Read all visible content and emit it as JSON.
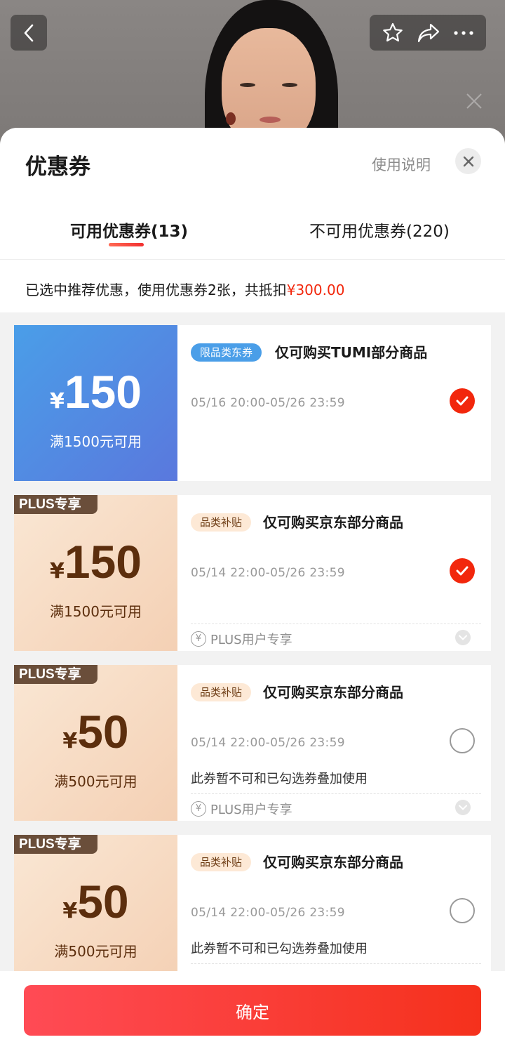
{
  "sheet": {
    "title": "优惠券",
    "usage_link": "使用说明",
    "tabs": [
      {
        "label": "可用优惠券(13)",
        "active": true
      },
      {
        "label": "不可用优惠券(220)",
        "active": false
      }
    ],
    "summary_prefix": "已选中推荐优惠，使用优惠券2张，共抵扣",
    "summary_amount": "¥300.00"
  },
  "coupons": [
    {
      "style": "blue",
      "plus_tag": "",
      "currency": "¥",
      "amount": "150",
      "condition": "满1500元可用",
      "tag": "限品类东券",
      "title": "仅可购买TUMI部分商品",
      "date": "05/16 20:00-05/26 23:59",
      "note": "",
      "selected": true,
      "plus_user": ""
    },
    {
      "style": "plus",
      "plus_tag": "PLUS专享",
      "currency": "¥",
      "amount": "150",
      "condition": "满1500元可用",
      "tag": "品类补贴",
      "title": "仅可购买京东部分商品",
      "date": "05/14 22:00-05/26 23:59",
      "note": "",
      "selected": true,
      "plus_user": "PLUS用户专享"
    },
    {
      "style": "plus",
      "plus_tag": "PLUS专享",
      "currency": "¥",
      "amount": "50",
      "condition": "满500元可用",
      "tag": "品类补贴",
      "title": "仅可购买京东部分商品",
      "date": "05/14 22:00-05/26 23:59",
      "note": "此券暂不可和已勾选券叠加使用",
      "selected": false,
      "plus_user": "PLUS用户专享"
    },
    {
      "style": "plus",
      "plus_tag": "PLUS专享",
      "currency": "¥",
      "amount": "50",
      "condition": "满500元可用",
      "tag": "品类补贴",
      "title": "仅可购买京东部分商品",
      "date": "05/14 22:00-05/26 23:59",
      "note": "此券暂不可和已勾选券叠加使用",
      "selected": false,
      "plus_user": ""
    }
  ],
  "footer": {
    "confirm_label": "确定"
  },
  "icons": {
    "back": "chevron-left-icon",
    "favorite": "star-icon",
    "share": "share-icon",
    "more": "more-icon",
    "close": "close-icon",
    "check": "check-icon",
    "expand": "chevron-down-icon",
    "plus_user": "yen-circle-icon"
  },
  "colors": {
    "accent_red": "#f2270c",
    "blue_coupon": "#4a9ee8",
    "plus_brown": "#5c2e0d"
  }
}
